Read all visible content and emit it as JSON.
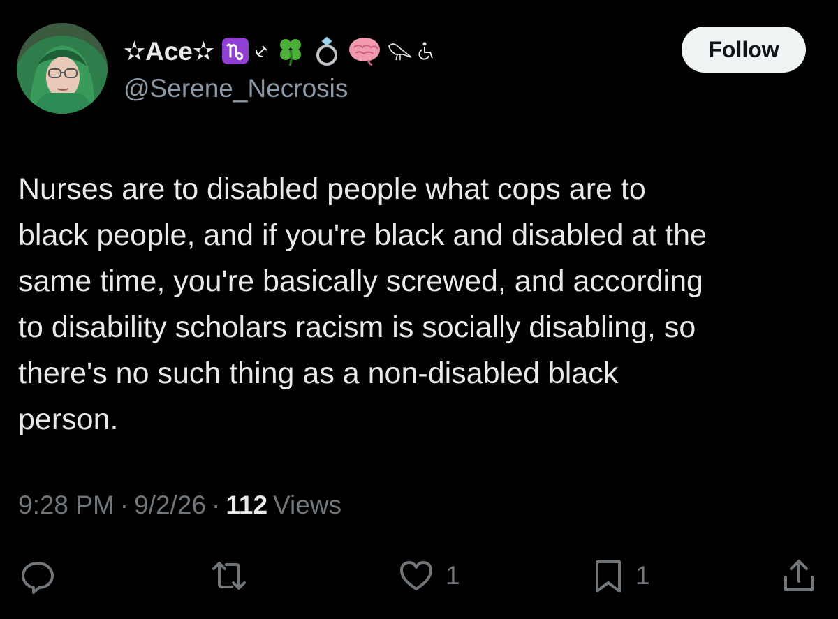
{
  "tweet": {
    "display_name": "✫Ace✫",
    "handle": "@Serene_Necrosis",
    "follow_label": "Follow",
    "text": "Nurses are to disabled people what cops are to\nblack people, and if you're black and disabled at the\nsame time, you're basically screwed, and according\nto disability scholars racism is socially disabling, so\nthere's no such thing as a non-disabled black\nperson.",
    "time": "9:28 PM",
    "separator": "·",
    "date": "9/2/26",
    "views_count": "112",
    "views_label": "Views"
  },
  "name_emojis": [
    "capricorn-icon",
    "hammer-sickle-icon",
    "four-leaf-clover-icon",
    "ring-icon",
    "brain-icon",
    "bird-icon",
    "wheelchair-icon"
  ],
  "actions": {
    "likes_count": "1",
    "bookmarks_count": "1"
  },
  "colors": {
    "background": "#000000",
    "text": "#e7e9ea",
    "secondary": "#71767b",
    "follow_bg": "#eff3f4",
    "capricorn": "#8f3fd1",
    "clover": "#4caf3a",
    "brain": "#f29bb0"
  }
}
